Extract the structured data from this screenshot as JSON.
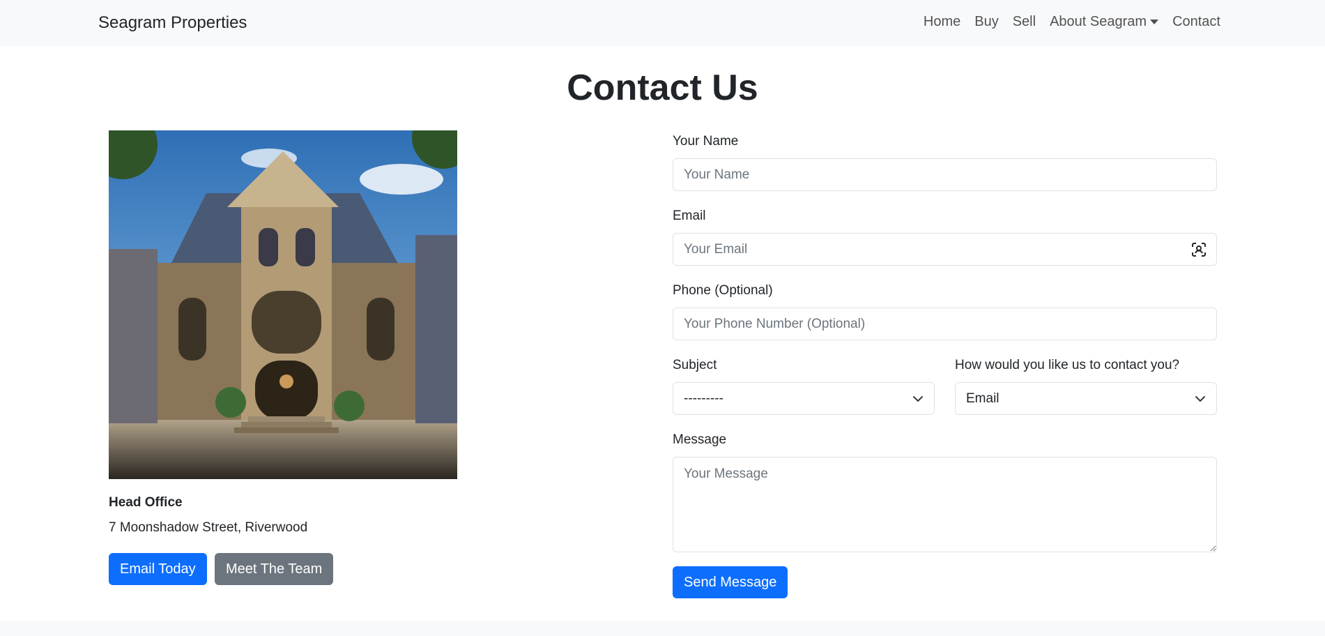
{
  "nav": {
    "brand": "Seagram Properties",
    "links": [
      "Home",
      "Buy",
      "Sell",
      "About Seagram",
      "Contact"
    ]
  },
  "page_title": "Contact Us",
  "office": {
    "heading": "Head Office",
    "address": "7 Moonshadow Street, Riverwood",
    "email_button": "Email Today",
    "team_button": "Meet The Team"
  },
  "form": {
    "name": {
      "label": "Your Name",
      "placeholder": "Your Name",
      "value": ""
    },
    "email": {
      "label": "Email",
      "placeholder": "Your Email",
      "value": ""
    },
    "phone": {
      "label": "Phone (Optional)",
      "placeholder": "Your Phone Number (Optional)",
      "value": ""
    },
    "subject": {
      "label": "Subject",
      "selected": "---------"
    },
    "contact_method": {
      "label": "How would you like us to contact you?",
      "selected": "Email"
    },
    "message": {
      "label": "Message",
      "placeholder": "Your Message",
      "value": ""
    },
    "submit": "Send Message"
  },
  "icons": {
    "email_field_icon": "contact-card-icon",
    "select_arrow": "chevron-down-icon"
  },
  "colors": {
    "primary": "#0d6efd",
    "secondary": "#6c757d",
    "navbar_bg": "#f8f9fa"
  }
}
